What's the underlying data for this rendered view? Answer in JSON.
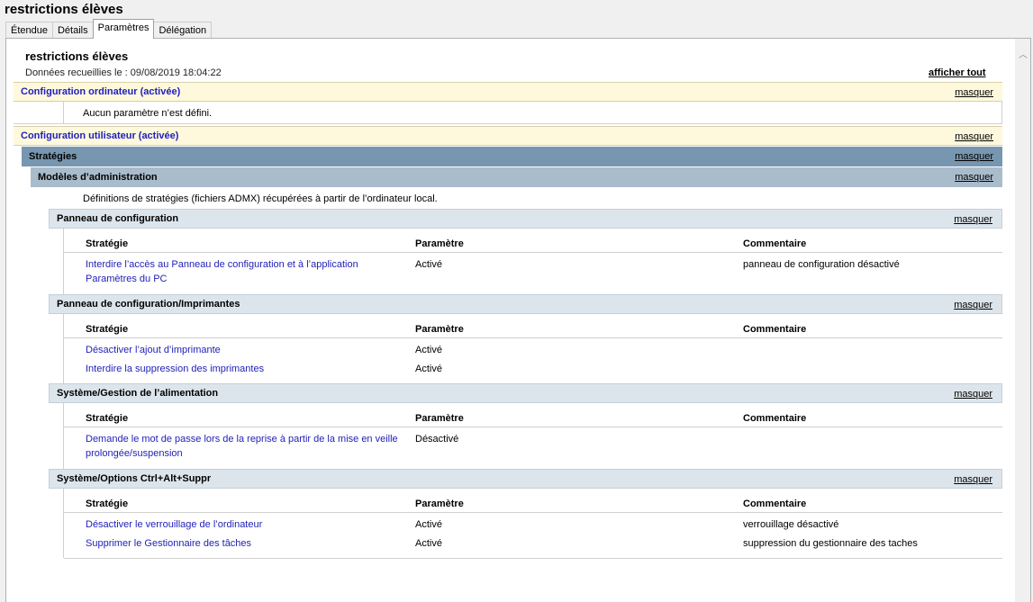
{
  "window": {
    "title": "restrictions élèves"
  },
  "tabs": [
    {
      "label": "Étendue",
      "active": false
    },
    {
      "label": "Détails",
      "active": false
    },
    {
      "label": "Paramètres",
      "active": true
    },
    {
      "label": "Délégation",
      "active": false
    }
  ],
  "report": {
    "title": "restrictions élèves",
    "collected": "Données recueillies le : 09/08/2019 18:04:22",
    "show_all": "afficher tout",
    "hide_label": "masquer"
  },
  "computer_config": {
    "title": "Configuration ordinateur (activée)",
    "message": "Aucun paramètre n’est défini."
  },
  "user_config": {
    "title": "Configuration utilisateur (activée)",
    "strategies": "Stratégies",
    "admin_templates": "Modèles d’administration",
    "admx_note": "Définitions de stratégies (fichiers ADMX) récupérées à partir de l’ordinateur local."
  },
  "table_headers": {
    "strategy": "Stratégie",
    "setting": "Paramètre",
    "comment": "Commentaire"
  },
  "groups": [
    {
      "title": "Panneau de configuration",
      "rows": [
        {
          "strategy_l1": "Interdire l’accès au Panneau de configuration et à l’application",
          "strategy_l2": "Paramètres du PC",
          "setting": "Activé",
          "comment": "panneau de configuration désactivé"
        }
      ]
    },
    {
      "title": "Panneau de configuration/Imprimantes",
      "rows": [
        {
          "strategy_l1": "Désactiver l’ajout d’imprimante",
          "setting": "Activé",
          "comment": ""
        },
        {
          "strategy_l1": "Interdire la suppression des imprimantes",
          "setting": "Activé",
          "comment": ""
        }
      ]
    },
    {
      "title": "Système/Gestion de l’alimentation",
      "rows": [
        {
          "strategy_l1": "Demande le mot de passe lors de la reprise à partir de la mise en veille",
          "strategy_l2": "prolongée/suspension",
          "setting": "Désactivé",
          "comment": ""
        }
      ]
    },
    {
      "title": "Système/Options Ctrl+Alt+Suppr",
      "rows": [
        {
          "strategy_l1": "Désactiver le verrouillage de l’ordinateur",
          "setting": "Activé",
          "comment": "verrouillage désactivé"
        },
        {
          "strategy_l1": "Supprimer le Gestionnaire des tâches",
          "setting": "Activé",
          "comment": "suppression du gestionnaire des taches"
        }
      ]
    }
  ]
}
